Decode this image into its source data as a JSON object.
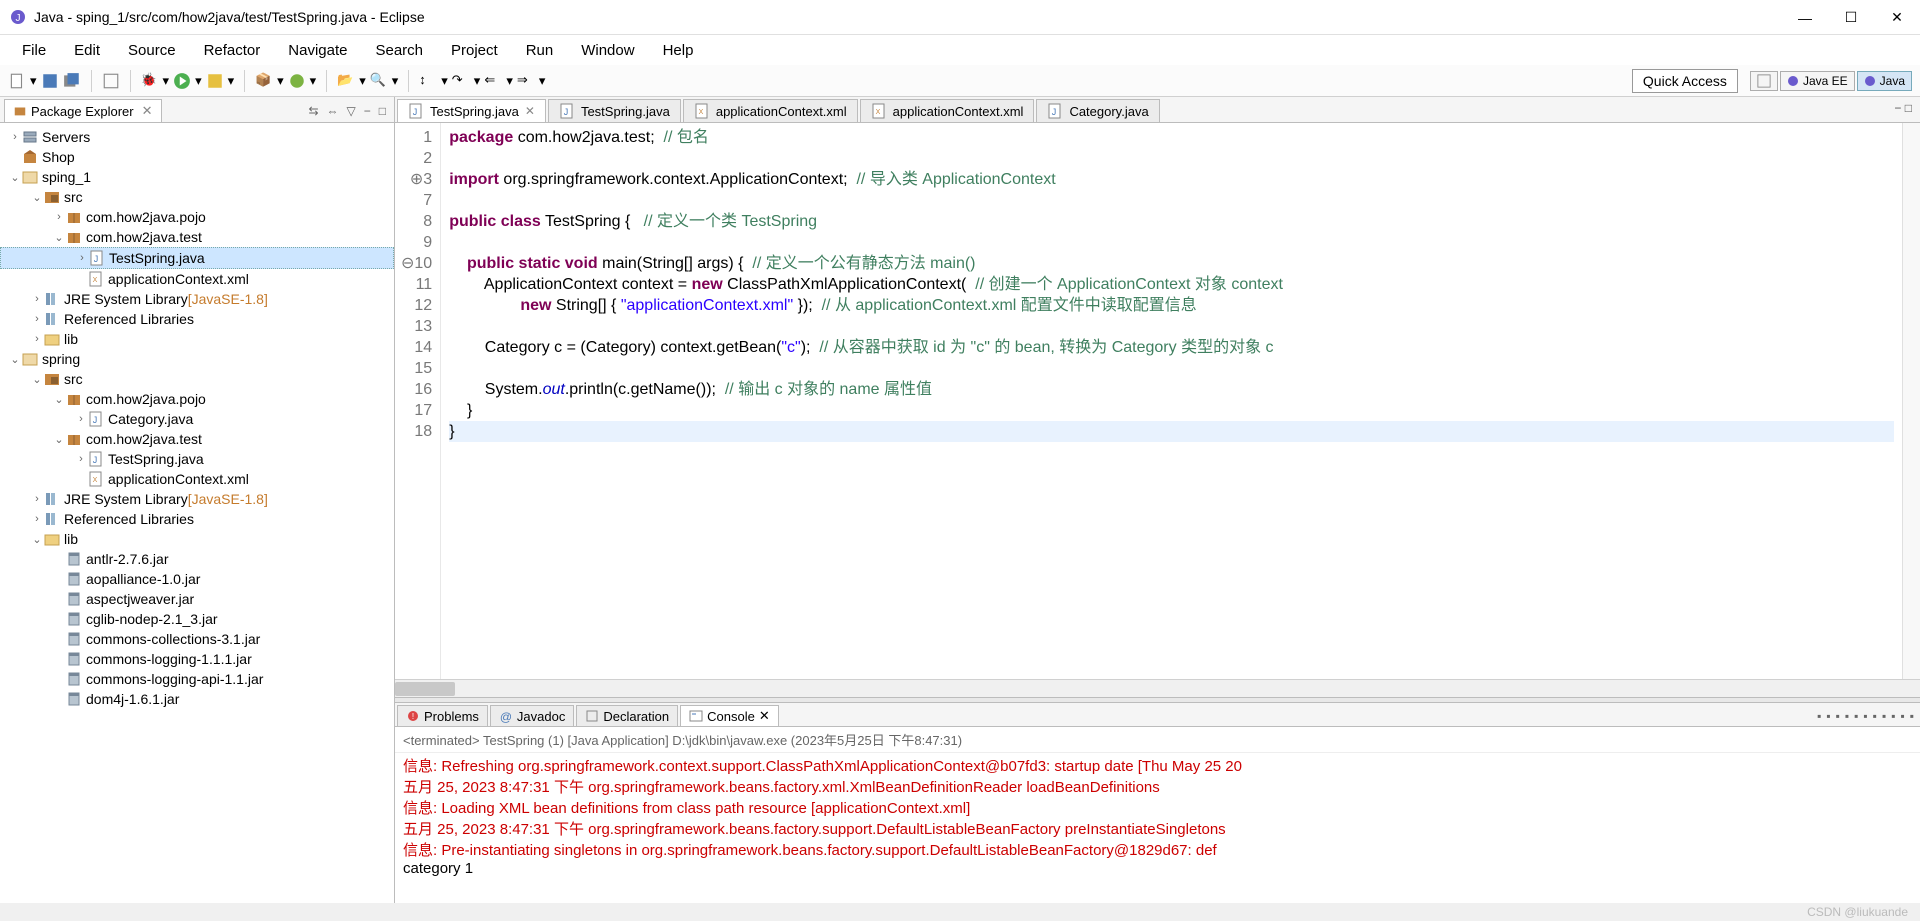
{
  "window": {
    "title": "Java - sping_1/src/com/how2java/test/TestSpring.java - Eclipse"
  },
  "menu": [
    "File",
    "Edit",
    "Source",
    "Refactor",
    "Navigate",
    "Search",
    "Project",
    "Run",
    "Window",
    "Help"
  ],
  "toolbar": {
    "quick_access": "Quick Access",
    "persp_javaee": "Java EE",
    "persp_java": "Java"
  },
  "package_explorer": {
    "title": "Package Explorer",
    "tree": [
      {
        "d": 0,
        "tw": ">",
        "ico": "server",
        "label": "Servers"
      },
      {
        "d": 0,
        "tw": "",
        "ico": "shop",
        "label": "Shop"
      },
      {
        "d": 0,
        "tw": "v",
        "ico": "proj",
        "label": "sping_1"
      },
      {
        "d": 1,
        "tw": "v",
        "ico": "srcf",
        "label": "src"
      },
      {
        "d": 2,
        "tw": ">",
        "ico": "pkg",
        "label": "com.how2java.pojo"
      },
      {
        "d": 2,
        "tw": "v",
        "ico": "pkg",
        "label": "com.how2java.test"
      },
      {
        "d": 3,
        "tw": ">",
        "ico": "java",
        "label": "TestSpring.java",
        "sel": true
      },
      {
        "d": 3,
        "tw": "",
        "ico": "xml",
        "label": "applicationContext.xml"
      },
      {
        "d": 1,
        "tw": ">",
        "ico": "lib",
        "label": "JRE System Library",
        "suffix": "[JavaSE-1.8]"
      },
      {
        "d": 1,
        "tw": ">",
        "ico": "lib",
        "label": "Referenced Libraries"
      },
      {
        "d": 1,
        "tw": ">",
        "ico": "fld",
        "label": "lib"
      },
      {
        "d": 0,
        "tw": "v",
        "ico": "proj",
        "label": "spring"
      },
      {
        "d": 1,
        "tw": "v",
        "ico": "srcf",
        "label": "src"
      },
      {
        "d": 2,
        "tw": "v",
        "ico": "pkg",
        "label": "com.how2java.pojo"
      },
      {
        "d": 3,
        "tw": ">",
        "ico": "java",
        "label": "Category.java"
      },
      {
        "d": 2,
        "tw": "v",
        "ico": "pkg",
        "label": "com.how2java.test"
      },
      {
        "d": 3,
        "tw": ">",
        "ico": "java",
        "label": "TestSpring.java"
      },
      {
        "d": 3,
        "tw": "",
        "ico": "xml",
        "label": "applicationContext.xml"
      },
      {
        "d": 1,
        "tw": ">",
        "ico": "lib",
        "label": "JRE System Library",
        "suffix": "[JavaSE-1.8]"
      },
      {
        "d": 1,
        "tw": ">",
        "ico": "lib",
        "label": "Referenced Libraries"
      },
      {
        "d": 1,
        "tw": "v",
        "ico": "fld",
        "label": "lib"
      },
      {
        "d": 2,
        "tw": "",
        "ico": "jar",
        "label": "antlr-2.7.6.jar"
      },
      {
        "d": 2,
        "tw": "",
        "ico": "jar",
        "label": "aopalliance-1.0.jar"
      },
      {
        "d": 2,
        "tw": "",
        "ico": "jar",
        "label": "aspectjweaver.jar"
      },
      {
        "d": 2,
        "tw": "",
        "ico": "jar",
        "label": "cglib-nodep-2.1_3.jar"
      },
      {
        "d": 2,
        "tw": "",
        "ico": "jar",
        "label": "commons-collections-3.1.jar"
      },
      {
        "d": 2,
        "tw": "",
        "ico": "jar",
        "label": "commons-logging-1.1.1.jar"
      },
      {
        "d": 2,
        "tw": "",
        "ico": "jar",
        "label": "commons-logging-api-1.1.jar"
      },
      {
        "d": 2,
        "tw": "",
        "ico": "jar",
        "label": "dom4j-1.6.1.jar"
      }
    ]
  },
  "editor_tabs": [
    {
      "ico": "java",
      "label": "TestSpring.java",
      "active": true,
      "close": true
    },
    {
      "ico": "java",
      "label": "TestSpring.java"
    },
    {
      "ico": "xml",
      "label": "applicationContext.xml"
    },
    {
      "ico": "xml",
      "label": "applicationContext.xml"
    },
    {
      "ico": "java",
      "label": "Category.java"
    }
  ],
  "code": {
    "lines": [
      {
        "n": 1,
        "html": "<span class='kw'>package</span> com.how2java.test;  <span class='cmt'>// 包名</span>"
      },
      {
        "n": 2,
        "html": ""
      },
      {
        "n": 3,
        "html": "<span class='kw'>import</span> org.springframework.context.ApplicationContext;  <span class='cmt'>// 导入类 ApplicationContext</span>",
        "mark": "⊕"
      },
      {
        "n": 7,
        "html": ""
      },
      {
        "n": 8,
        "html": "<span class='kw'>public class</span> TestSpring {   <span class='cmt'>// 定义一个类 TestSpring</span>"
      },
      {
        "n": 9,
        "html": ""
      },
      {
        "n": 10,
        "html": "    <span class='kw'>public static void</span> main(String[] args) {  <span class='cmt'>// 定义一个公有静态方法 main()</span>",
        "mark": "⊖"
      },
      {
        "n": 11,
        "html": "        ApplicationContext context = <span class='kw'>new</span> ClassPathXmlApplicationContext(  <span class='cmt'>// 创建一个 ApplicationContext 对象 context</span>"
      },
      {
        "n": 12,
        "html": "                <span class='kw'>new</span> String[] { <span class='str'>\"applicationContext.xml\"</span> });  <span class='cmt'>// 从 applicationContext.xml 配置文件中读取配置信息</span>"
      },
      {
        "n": 13,
        "html": ""
      },
      {
        "n": 14,
        "html": "        Category c = (Category) context.getBean(<span class='str'>\"c\"</span>);  <span class='cmt'>// 从容器中获取 id 为 \"c\" 的 bean, 转换为 Category 类型的对象 c</span>"
      },
      {
        "n": 15,
        "html": ""
      },
      {
        "n": 16,
        "html": "        System.<span class='fld'>out</span>.println(c.getName());  <span class='cmt'>// 输出 c 对象的 name 属性值</span>"
      },
      {
        "n": 17,
        "html": "    }"
      },
      {
        "n": 18,
        "html": "}",
        "hl": true
      }
    ]
  },
  "bottom_tabs": [
    {
      "ico": "problems",
      "label": "Problems"
    },
    {
      "ico": "javadoc",
      "label": "Javadoc"
    },
    {
      "ico": "decl",
      "label": "Declaration"
    },
    {
      "ico": "console",
      "label": "Console",
      "active": true,
      "close": true
    }
  ],
  "console": {
    "header": "<terminated> TestSpring (1) [Java Application] D:\\jdk\\bin\\javaw.exe (2023年5月25日 下午8:47:31)",
    "lines": [
      {
        "red": true,
        "text": "信息: Refreshing org.springframework.context.support.ClassPathXmlApplicationContext@b07fd3: startup date [Thu May 25 20"
      },
      {
        "red": true,
        "text": "五月 25, 2023 8:47:31 下午 org.springframework.beans.factory.xml.XmlBeanDefinitionReader loadBeanDefinitions"
      },
      {
        "red": true,
        "text": "信息: Loading XML bean definitions from class path resource [applicationContext.xml]"
      },
      {
        "red": true,
        "text": "五月 25, 2023 8:47:31 下午 org.springframework.beans.factory.support.DefaultListableBeanFactory preInstantiateSingletons"
      },
      {
        "red": true,
        "text": "信息: Pre-instantiating singletons in org.springframework.beans.factory.support.DefaultListableBeanFactory@1829d67: def"
      },
      {
        "red": false,
        "text": "category 1"
      }
    ]
  },
  "watermark": "CSDN @liukuande"
}
